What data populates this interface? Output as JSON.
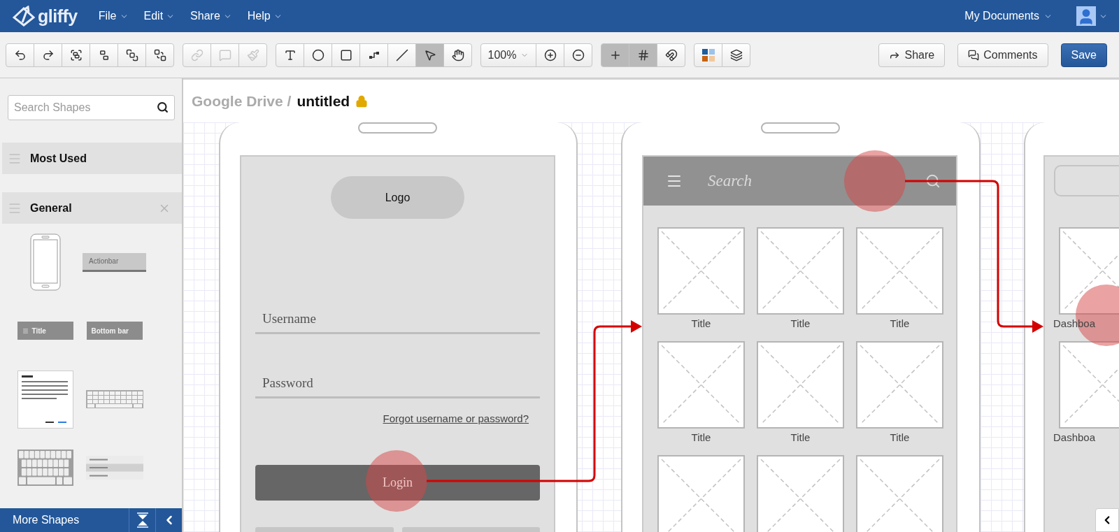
{
  "top_bar": {
    "brand": "gliffy",
    "menus": [
      {
        "label": "File"
      },
      {
        "label": "Edit"
      },
      {
        "label": "Share"
      },
      {
        "label": "Help"
      }
    ],
    "account": {
      "label": "My Documents"
    }
  },
  "toolbar": {
    "groups": [
      {
        "disabled": false,
        "buttons": [
          {
            "kind": "undo"
          },
          {
            "kind": "redo"
          },
          {
            "kind": "group"
          },
          {
            "kind": "ungroup"
          },
          {
            "kind": "bring_front"
          },
          {
            "kind": "send_back"
          }
        ]
      },
      {
        "disabled": true,
        "buttons": [
          {
            "kind": "link"
          },
          {
            "kind": "comment"
          },
          {
            "kind": "style"
          }
        ]
      },
      {
        "disabled": false,
        "buttons": [
          {
            "kind": "text",
            "selected": false
          },
          {
            "kind": "ellipse",
            "selected": false
          },
          {
            "kind": "rectangle",
            "selected": false
          },
          {
            "kind": "connector",
            "selected": false
          },
          {
            "kind": "line",
            "selected": false
          },
          {
            "kind": "pointer",
            "selected": true
          },
          {
            "kind": "hand",
            "selected": false
          }
        ]
      },
      {
        "disabled": false,
        "zoom": "100%",
        "buttons": [
          {
            "kind": "zoom_in"
          },
          {
            "kind": "zoom_out"
          }
        ]
      },
      {
        "disabled": false,
        "buttons": [
          {
            "kind": "guides",
            "on": true
          },
          {
            "kind": "grid",
            "on": true
          },
          {
            "kind": "snap",
            "on": false
          }
        ]
      },
      {
        "disabled": false,
        "buttons": [
          {
            "kind": "themes"
          },
          {
            "kind": "layers"
          }
        ]
      }
    ],
    "actions": [
      {
        "kind": "share",
        "label": "Share"
      },
      {
        "kind": "comments",
        "label": "Comments"
      },
      {
        "kind": "save",
        "label": "Save"
      }
    ]
  },
  "sidebar": {
    "search": {
      "placeholder": "Search Shapes"
    },
    "sections": [
      {
        "title": "Most Used",
        "closable": false
      },
      {
        "title": "General",
        "closable": true,
        "shapes": [
          {
            "kind": "phone"
          },
          {
            "kind": "actionbar",
            "label": "Actionbar"
          },
          {
            "kind": "titlebar",
            "label": "Title"
          },
          {
            "kind": "bottombar",
            "label": "Bottom bar"
          },
          {
            "kind": "dialog"
          },
          {
            "kind": "keyboard_small"
          },
          {
            "kind": "keyboard"
          },
          {
            "kind": "list"
          }
        ]
      }
    ],
    "footer": {
      "label": "More Shapes"
    }
  },
  "canvas": {
    "breadcrumb": {
      "folder": "Google Drive /",
      "title": "untitled",
      "locked": true
    },
    "screens": [
      {
        "kind": "login",
        "logo": "Logo",
        "fields": [
          {
            "placeholder": "Username"
          },
          {
            "placeholder": "Password"
          }
        ],
        "link": "Forgot username or password?",
        "button": "Login"
      },
      {
        "kind": "gallery",
        "search": {
          "placeholder": "Search"
        },
        "tiles": [
          {
            "kind": "image",
            "caption": "Title"
          },
          {
            "kind": "image",
            "caption": "Title"
          },
          {
            "kind": "image",
            "caption": "Title"
          },
          {
            "kind": "image",
            "caption": "Title"
          },
          {
            "kind": "image",
            "caption": "Title"
          },
          {
            "kind": "image",
            "caption": "Title"
          },
          {
            "kind": "image"
          },
          {
            "kind": "image"
          },
          {
            "kind": "image"
          }
        ]
      },
      {
        "kind": "dashboard",
        "tiles": [
          {
            "kind": "image",
            "caption": "Dashboa"
          },
          {
            "kind": "image",
            "caption": "Dashboa"
          }
        ]
      }
    ]
  }
}
